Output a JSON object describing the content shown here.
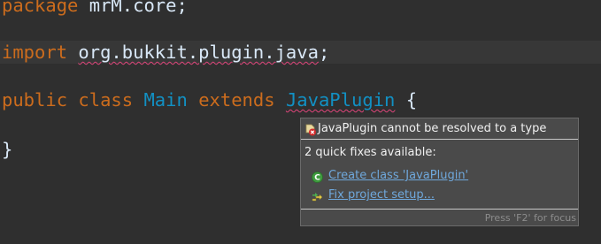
{
  "editor": {
    "lines": {
      "package": {
        "keyword": "package",
        "rest": " mrM.core;"
      },
      "import": {
        "keyword": "import",
        "package_path": "org.bukkit.plugin.java",
        "end": ";"
      },
      "class_decl": {
        "kw_public": "public",
        "kw_class": "class",
        "class_name": "Main",
        "kw_extends": "extends",
        "super_name": "JavaPlugin",
        "brace": "{"
      },
      "closing": "}"
    }
  },
  "hover": {
    "title": "JavaPlugin cannot be resolved to a type",
    "quick_fix_title": "2 quick fixes available:",
    "fixes": [
      {
        "label": "Create class 'JavaPlugin'",
        "icon": "create-class-icon"
      },
      {
        "label": "Fix project setup...",
        "icon": "fix-setup-icon"
      }
    ],
    "footer": "Press 'F2' for focus",
    "error_icon": "error-icon"
  },
  "colors": {
    "background": "#2f2f2f",
    "keyword": "#cc6c1d",
    "type": "#1290c3",
    "text": "#d9e8f7",
    "error_underline": "#e0457b",
    "link": "#6fa8dc"
  }
}
